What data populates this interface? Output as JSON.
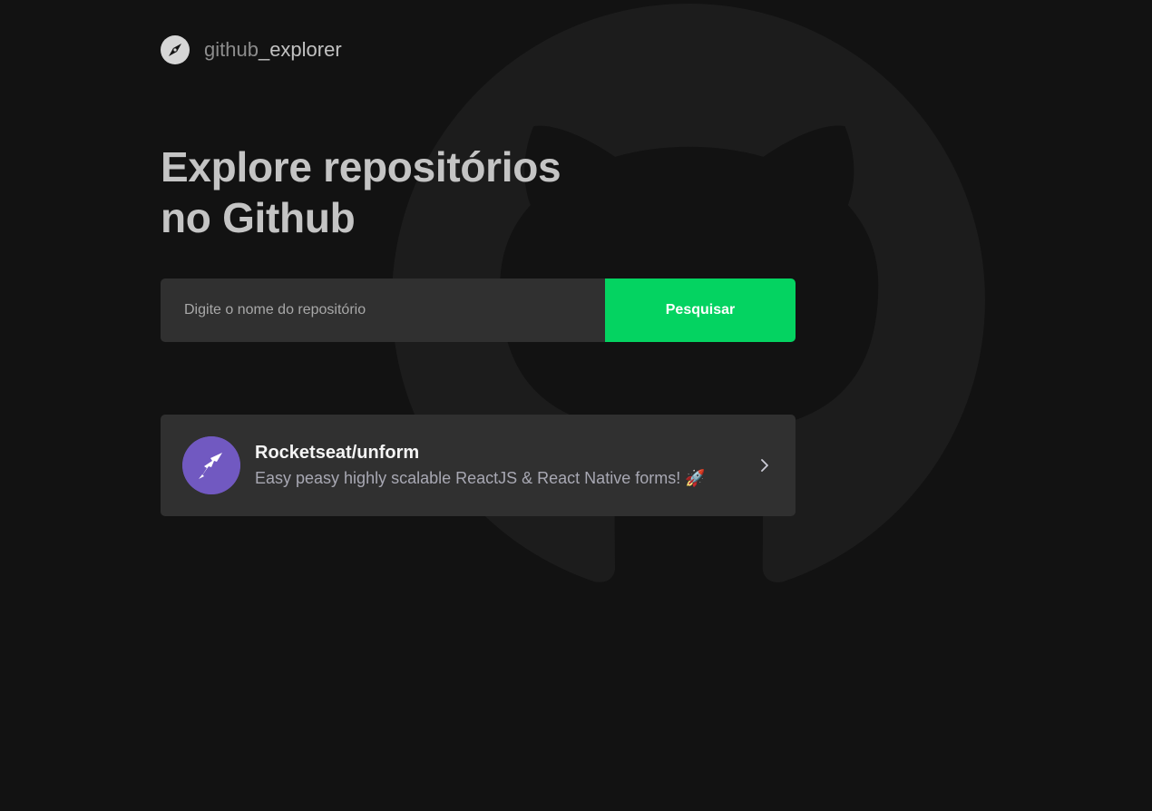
{
  "app": {
    "logo_text_part1": "github",
    "logo_text_part2": "_explorer",
    "logo_icon": "compass-icon"
  },
  "hero": {
    "title_line1": "Explore repositórios",
    "title_line2": "no Github"
  },
  "search": {
    "placeholder": "Digite o nome do repositório",
    "value": "",
    "button_label": "Pesquisar"
  },
  "repositories": [
    {
      "full_name": "Rocketseat/unform",
      "description": "Easy peasy highly scalable ReactJS & React Native forms! 🚀",
      "avatar_icon": "unform-logo-icon",
      "chevron_icon": "chevron-right-icon"
    }
  ],
  "colors": {
    "background": "#121212",
    "accent": "#04d361",
    "card": "#303030",
    "avatar_bg": "#7159c1",
    "title": "#c4c4c4"
  }
}
